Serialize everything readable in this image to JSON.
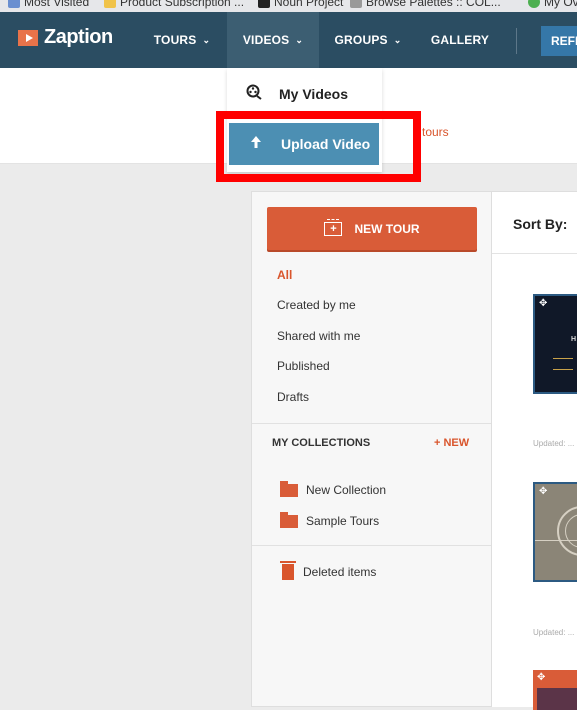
{
  "bookmarks": [
    "Most Visited",
    "Product Subscription ...",
    "Noun Project",
    "Browse Palettes :: COL...",
    "My Ov"
  ],
  "nav": {
    "logo": "Zaption",
    "items": [
      {
        "label": "TOURS",
        "has_chevron": true
      },
      {
        "label": "VIDEOS",
        "has_chevron": true,
        "active": true
      },
      {
        "label": "GROUPS",
        "has_chevron": true
      },
      {
        "label": "GALLERY",
        "has_chevron": false
      }
    ],
    "refer_label": "REFE",
    "chevron": "⌄"
  },
  "band": {
    "link_text": "tours"
  },
  "dropdown": {
    "items": [
      {
        "label": "My Videos",
        "icon": "video-reel-icon"
      },
      {
        "label": "Upload Video",
        "icon": "upload-arrow-icon",
        "highlighted": true
      }
    ]
  },
  "sidebar": {
    "new_tour_label": "NEW TOUR",
    "filters": [
      "All",
      "Created by me",
      "Shared with me",
      "Published",
      "Drafts"
    ],
    "active_filter": "All",
    "collections_title": "MY COLLECTIONS",
    "collections_new": "+ NEW",
    "collections": [
      "New Collection",
      "Sample Tours"
    ],
    "deleted_label": "Deleted items"
  },
  "main": {
    "sort_label": "Sort By:",
    "updated_label": "Updated: ...",
    "thumb1_text": "H"
  },
  "colors": {
    "nav_bg": "#2b4d62",
    "accent": "#d95c38",
    "dropdown_highlight": "#4c8fb3",
    "annotation_box": "#ff0000"
  }
}
